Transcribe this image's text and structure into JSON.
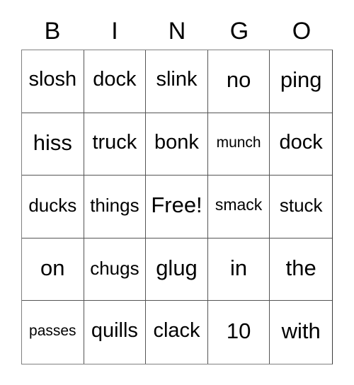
{
  "card": {
    "title": "BINGO card",
    "header_letters": [
      "B",
      "I",
      "N",
      "G",
      "O"
    ],
    "columns": 5,
    "rows": 5,
    "free_space_label": "Free!",
    "free_space_position": [
      2,
      2
    ],
    "text_color": "#000000",
    "background_color": "#ffffff",
    "border_color": "#555555",
    "cells": [
      [
        {
          "label": "slosh",
          "size": "lg"
        },
        {
          "label": "dock",
          "size": "lg"
        },
        {
          "label": "slink",
          "size": "lg"
        },
        {
          "label": "no",
          "size": "xl"
        },
        {
          "label": "ping",
          "size": "xl"
        }
      ],
      [
        {
          "label": "hiss",
          "size": "xl"
        },
        {
          "label": "truck",
          "size": "lg"
        },
        {
          "label": "bonk",
          "size": "lg"
        },
        {
          "label": "munch",
          "size": "xs"
        },
        {
          "label": "dock",
          "size": "lg"
        }
      ],
      [
        {
          "label": "ducks",
          "size": "md"
        },
        {
          "label": "things",
          "size": "md"
        },
        {
          "label": "Free!",
          "size": "xl"
        },
        {
          "label": "smack",
          "size": "sm"
        },
        {
          "label": "stuck",
          "size": "md"
        }
      ],
      [
        {
          "label": "on",
          "size": "xl"
        },
        {
          "label": "chugs",
          "size": "md"
        },
        {
          "label": "glug",
          "size": "xl"
        },
        {
          "label": "in",
          "size": "xl"
        },
        {
          "label": "the",
          "size": "xl"
        }
      ],
      [
        {
          "label": "passes",
          "size": "xs"
        },
        {
          "label": "quills",
          "size": "lg"
        },
        {
          "label": "clack",
          "size": "lg"
        },
        {
          "label": "10",
          "size": "xl"
        },
        {
          "label": "with",
          "size": "xl"
        }
      ]
    ]
  }
}
